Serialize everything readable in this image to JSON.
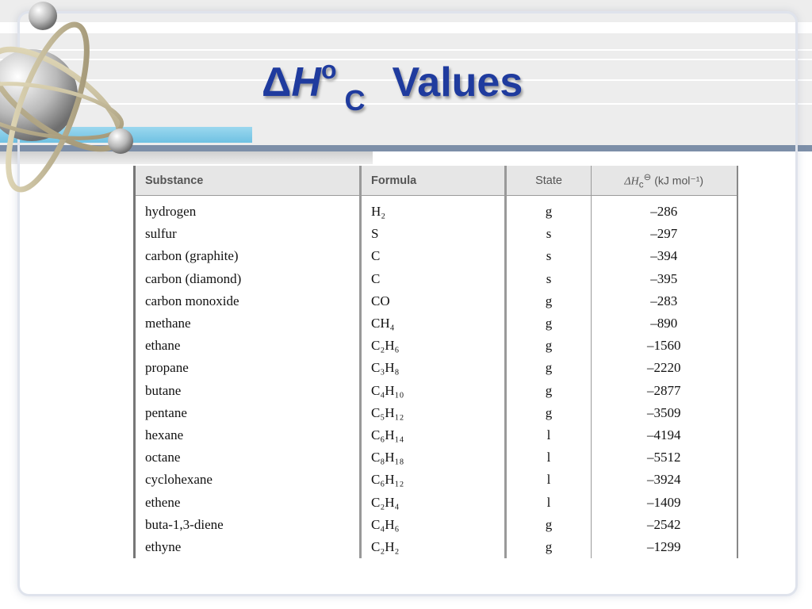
{
  "slide": {
    "title_delta": "Δ",
    "title_h": "H",
    "title_degree": "o",
    "title_sub": "C",
    "title_word": "Values"
  },
  "table": {
    "headers": {
      "substance": "Substance",
      "formula": "Formula",
      "state": "State",
      "dh_symbol": "ΔH",
      "dh_sup": "⊖",
      "dh_sub": "c",
      "dh_unit": "(kJ mol⁻¹)"
    },
    "rows": [
      {
        "substance": "hydrogen",
        "formula": "H₂",
        "state": "g",
        "dh": "–286"
      },
      {
        "substance": "sulfur",
        "formula": "S",
        "state": "s",
        "dh": "–297"
      },
      {
        "substance": "carbon (graphite)",
        "formula": "C",
        "state": "s",
        "dh": "–394"
      },
      {
        "substance": "carbon (diamond)",
        "formula": "C",
        "state": "s",
        "dh": "–395"
      },
      {
        "substance": "carbon monoxide",
        "formula": "CO",
        "state": "g",
        "dh": "–283"
      },
      {
        "substance": "methane",
        "formula": "CH₄",
        "state": "g",
        "dh": "–890"
      },
      {
        "substance": "ethane",
        "formula": "C₂H₆",
        "state": "g",
        "dh": "–1560"
      },
      {
        "substance": "propane",
        "formula": "C₃H₈",
        "state": "g",
        "dh": "–2220"
      },
      {
        "substance": "butane",
        "formula": "C₄H₁₀",
        "state": "g",
        "dh": "–2877"
      },
      {
        "substance": "pentane",
        "formula": "C₅H₁₂",
        "state": "g",
        "dh": "–3509"
      },
      {
        "substance": "hexane",
        "formula": "C₆H₁₄",
        "state": "l",
        "dh": "–4194"
      },
      {
        "substance": "octane",
        "formula": "C₈H₁₈",
        "state": "l",
        "dh": "–5512"
      },
      {
        "substance": "cyclohexane",
        "formula": "C₆H₁₂",
        "state": "l",
        "dh": "–3924"
      },
      {
        "substance": "ethene",
        "formula": "C₂H₄",
        "state": "l",
        "dh": "–1409"
      },
      {
        "substance": "buta-1,3-diene",
        "formula": "C₄H₆",
        "state": "g",
        "dh": "–2542"
      },
      {
        "substance": "ethyne",
        "formula": "C₂H₂",
        "state": "g",
        "dh": "–1299"
      }
    ]
  },
  "colors": {
    "title": "#1f3b9e",
    "header_band": "#ededed",
    "accent_bar": "#7d8fa8",
    "cyan_bar": "#6fc1e2"
  }
}
